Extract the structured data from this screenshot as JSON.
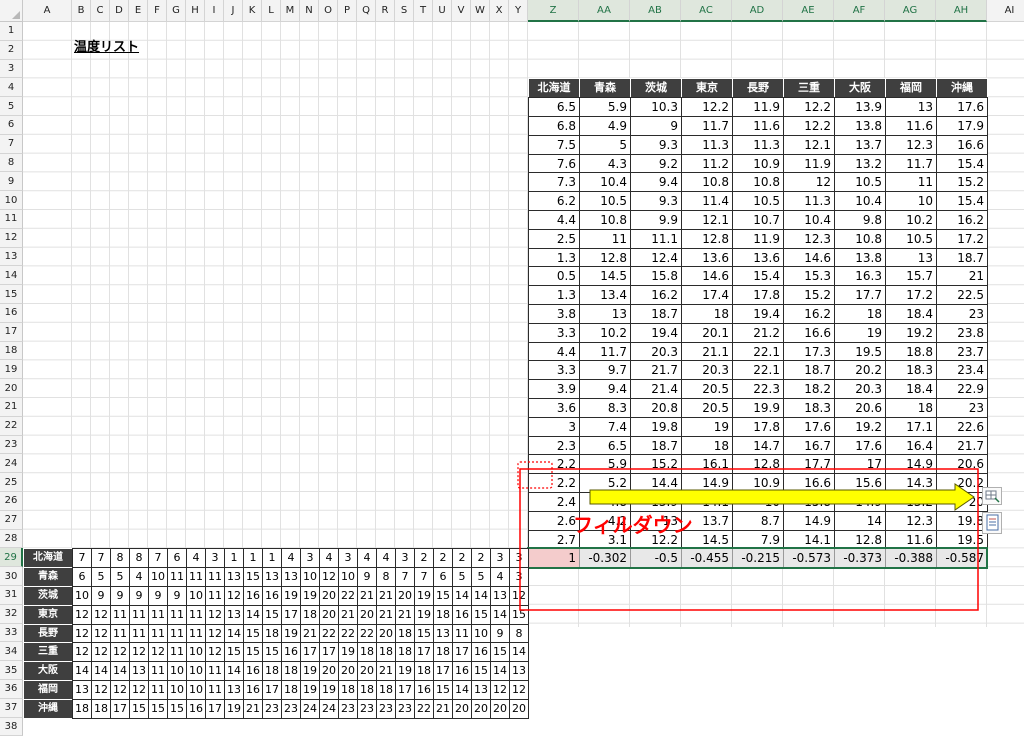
{
  "app": {
    "sheet_title": "温度リスト",
    "annotation": "フィルダウン",
    "column_letters": [
      "A",
      "B",
      "C",
      "D",
      "E",
      "F",
      "G",
      "H",
      "I",
      "J",
      "K",
      "L",
      "M",
      "N",
      "O",
      "P",
      "Q",
      "R",
      "S",
      "T",
      "U",
      "V",
      "W",
      "X",
      "Y",
      "Z",
      "AA",
      "AB",
      "AC",
      "AD",
      "AE",
      "AF",
      "AG",
      "AH",
      "AI"
    ],
    "row_numbers": [
      "1",
      "2",
      "3",
      "4",
      "5",
      "6",
      "7",
      "8",
      "9",
      "10",
      "11",
      "12",
      "13",
      "14",
      "15",
      "16",
      "17",
      "18",
      "19",
      "20",
      "21",
      "22",
      "23",
      "24",
      "25",
      "26",
      "27",
      "28",
      "29",
      "30",
      "31",
      "32",
      "33",
      "34",
      "35",
      "36",
      "37",
      "38"
    ]
  },
  "temperature_table": {
    "headers": [
      "北海道",
      "青森",
      "茨城",
      "東京",
      "長野",
      "三重",
      "大阪",
      "福岡",
      "沖縄"
    ],
    "rows": [
      [
        "6.5",
        "5.9",
        "10.3",
        "12.2",
        "11.9",
        "12.2",
        "13.9",
        "13",
        "17.6"
      ],
      [
        "6.8",
        "4.9",
        "9",
        "11.7",
        "11.6",
        "12.2",
        "13.8",
        "11.6",
        "17.9"
      ],
      [
        "7.5",
        "5",
        "9.3",
        "11.3",
        "11.3",
        "12.1",
        "13.7",
        "12.3",
        "16.6"
      ],
      [
        "7.6",
        "4.3",
        "9.2",
        "11.2",
        "10.9",
        "11.9",
        "13.2",
        "11.7",
        "15.4"
      ],
      [
        "7.3",
        "10.4",
        "9.4",
        "10.8",
        "10.8",
        "12",
        "10.5",
        "11",
        "15.2"
      ],
      [
        "6.2",
        "10.5",
        "9.3",
        "11.4",
        "10.5",
        "11.3",
        "10.4",
        "10",
        "15.4"
      ],
      [
        "4.4",
        "10.8",
        "9.9",
        "12.1",
        "10.7",
        "10.4",
        "9.8",
        "10.2",
        "16.2"
      ],
      [
        "2.5",
        "11",
        "11.1",
        "12.8",
        "11.9",
        "12.3",
        "10.8",
        "10.5",
        "17.2"
      ],
      [
        "1.3",
        "12.8",
        "12.4",
        "13.6",
        "13.6",
        "14.6",
        "13.8",
        "13",
        "18.7"
      ],
      [
        "0.5",
        "14.5",
        "15.8",
        "14.6",
        "15.4",
        "15.3",
        "16.3",
        "15.7",
        "21"
      ],
      [
        "1.3",
        "13.4",
        "16.2",
        "17.4",
        "17.8",
        "15.2",
        "17.7",
        "17.2",
        "22.5"
      ],
      [
        "3.8",
        "13",
        "18.7",
        "18",
        "19.4",
        "16.2",
        "18",
        "18.4",
        "23"
      ],
      [
        "3.3",
        "10.2",
        "19.4",
        "20.1",
        "21.2",
        "16.6",
        "19",
        "19.2",
        "23.8"
      ],
      [
        "4.4",
        "11.7",
        "20.3",
        "21.1",
        "22.1",
        "17.3",
        "19.5",
        "18.8",
        "23.7"
      ],
      [
        "3.3",
        "9.7",
        "21.7",
        "20.3",
        "22.1",
        "18.7",
        "20.2",
        "18.3",
        "23.4"
      ],
      [
        "3.9",
        "9.4",
        "21.4",
        "20.5",
        "22.3",
        "18.2",
        "20.3",
        "18.4",
        "22.9"
      ],
      [
        "3.6",
        "8.3",
        "20.8",
        "20.5",
        "19.9",
        "18.3",
        "20.6",
        "18",
        "23"
      ],
      [
        "3",
        "7.4",
        "19.8",
        "19",
        "17.8",
        "17.6",
        "19.2",
        "17.1",
        "22.6"
      ],
      [
        "2.3",
        "6.5",
        "18.7",
        "18",
        "14.7",
        "16.7",
        "17.6",
        "16.4",
        "21.7"
      ],
      [
        "2.2",
        "5.9",
        "15.2",
        "16.1",
        "12.8",
        "17.7",
        "17",
        "14.9",
        "20.6"
      ],
      [
        "2.2",
        "5.2",
        "14.4",
        "14.9",
        "10.9",
        "16.6",
        "15.6",
        "14.3",
        "20.2"
      ],
      [
        "2.4",
        "4.8",
        "13.9",
        "14.1",
        "10",
        "15.8",
        "14.9",
        "13.2",
        "20"
      ],
      [
        "2.6",
        "4.2",
        "13",
        "13.7",
        "8.7",
        "14.9",
        "14",
        "12.3",
        "19.8"
      ],
      [
        "2.7",
        "3.1",
        "12.2",
        "14.5",
        "7.9",
        "14.1",
        "12.8",
        "11.6",
        "19.5"
      ]
    ]
  },
  "correlation_row": [
    "1",
    "-0.302",
    "-0.5",
    "-0.455",
    "-0.215",
    "-0.573",
    "-0.373",
    "-0.388",
    "-0.587"
  ],
  "small_table": {
    "row_headers": [
      "北海道",
      "青森",
      "茨城",
      "東京",
      "長野",
      "三重",
      "大阪",
      "福岡",
      "沖縄"
    ],
    "rows": [
      [
        "7",
        "7",
        "8",
        "8",
        "7",
        "6",
        "4",
        "3",
        "1",
        "1",
        "1",
        "4",
        "3",
        "4",
        "3",
        "4",
        "4",
        "3",
        "2",
        "2",
        "2",
        "2",
        "3",
        "3"
      ],
      [
        "6",
        "5",
        "5",
        "4",
        "10",
        "11",
        "11",
        "11",
        "13",
        "15",
        "13",
        "13",
        "10",
        "12",
        "10",
        "9",
        "8",
        "7",
        "7",
        "6",
        "5",
        "5",
        "4",
        "3"
      ],
      [
        "10",
        "9",
        "9",
        "9",
        "9",
        "9",
        "10",
        "11",
        "12",
        "16",
        "16",
        "19",
        "19",
        "20",
        "22",
        "21",
        "21",
        "20",
        "19",
        "15",
        "14",
        "14",
        "13",
        "12"
      ],
      [
        "12",
        "12",
        "11",
        "11",
        "11",
        "11",
        "11",
        "12",
        "13",
        "14",
        "15",
        "17",
        "18",
        "20",
        "21",
        "20",
        "21",
        "21",
        "19",
        "18",
        "16",
        "15",
        "14",
        "15"
      ],
      [
        "12",
        "12",
        "11",
        "11",
        "11",
        "11",
        "11",
        "12",
        "14",
        "15",
        "18",
        "19",
        "21",
        "22",
        "22",
        "22",
        "20",
        "18",
        "15",
        "13",
        "11",
        "10",
        "9",
        "8"
      ],
      [
        "12",
        "12",
        "12",
        "12",
        "12",
        "11",
        "10",
        "12",
        "15",
        "15",
        "15",
        "16",
        "17",
        "17",
        "19",
        "18",
        "18",
        "18",
        "17",
        "18",
        "17",
        "16",
        "15",
        "14"
      ],
      [
        "14",
        "14",
        "14",
        "13",
        "11",
        "10",
        "10",
        "11",
        "14",
        "16",
        "18",
        "18",
        "19",
        "20",
        "20",
        "20",
        "21",
        "19",
        "18",
        "17",
        "16",
        "15",
        "14",
        "13"
      ],
      [
        "13",
        "12",
        "12",
        "12",
        "11",
        "10",
        "10",
        "11",
        "13",
        "16",
        "17",
        "18",
        "19",
        "19",
        "18",
        "18",
        "18",
        "17",
        "16",
        "15",
        "14",
        "13",
        "12",
        "12"
      ],
      [
        "18",
        "18",
        "17",
        "15",
        "15",
        "15",
        "16",
        "17",
        "19",
        "21",
        "23",
        "23",
        "24",
        "24",
        "23",
        "23",
        "23",
        "23",
        "22",
        "21",
        "20",
        "20",
        "20",
        "20"
      ]
    ]
  },
  "colors": {
    "header_bg": "#3f3f3f",
    "highlight": "#f4cccc",
    "annotation": "#ff0000",
    "arrow": "#ffff00",
    "selection": "#217346"
  }
}
